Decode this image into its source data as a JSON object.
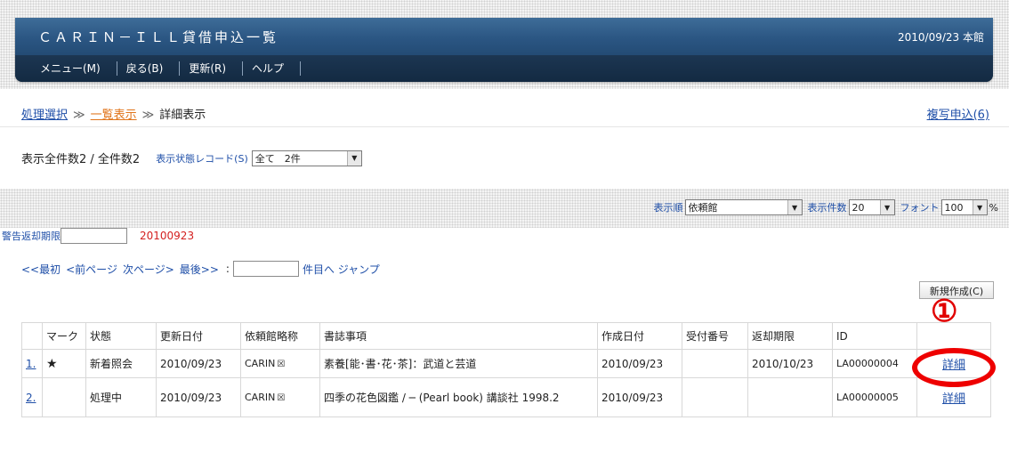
{
  "header": {
    "title": "ＣＡＲＩＮ－ＩＬＬ貸借申込一覧",
    "date_branch": "2010/09/23 本館",
    "menu": [
      {
        "label": "メニュー(M)"
      },
      {
        "label": "戻る(B)"
      },
      {
        "label": "更新(R)"
      },
      {
        "label": "ヘルプ"
      }
    ]
  },
  "breadcrumb": {
    "step1": "処理選択",
    "sep": "≫",
    "step2": "一覧表示",
    "step3": "詳細表示"
  },
  "copy_request": "複写申込(6)",
  "counts": {
    "text": "表示全件数2 / 全件数2",
    "status_label": "表示状態レコード(S)",
    "status_value": "全て　2件"
  },
  "controls": {
    "sort_label": "表示順",
    "sort_value": "依頼館",
    "perpage_label": "表示件数",
    "perpage_value": "20",
    "font_label": "フォント",
    "font_value": "100",
    "font_unit": "%"
  },
  "warning": {
    "label": "警告返却期限",
    "value": "",
    "date": "20100923"
  },
  "pager": {
    "first": "<<最初",
    "prev": "<前ページ",
    "next": "次ページ>",
    "last": "最後>>",
    "colon": ":",
    "jump_value": "",
    "jump_label": "件目へ ジャンプ"
  },
  "new_button": "新規作成(C)",
  "annotation": "①",
  "table": {
    "headers": [
      "",
      "マーク",
      "状態",
      "更新日付",
      "依頼館略称",
      "書誌事項",
      "作成日付",
      "受付番号",
      "返却期限",
      "ID",
      ""
    ],
    "rows": [
      {
        "no": "1.",
        "mark": "★",
        "status": "新着照会",
        "updated": "2010/09/23",
        "library": "CARIN",
        "library_icon": "☒",
        "bib": "素養[能･書･花･茶]：武道と芸道",
        "created": "2010/09/23",
        "receipt": "",
        "due": "2010/10/23",
        "id": "LA00000004",
        "detail": "詳細"
      },
      {
        "no": "2.",
        "mark": "",
        "status": "処理中",
        "updated": "2010/09/23",
        "library": "CARIN",
        "library_icon": "☒",
        "bib": "四季の花色図鑑 / ─ (Pearl book) 講談社 1998.2",
        "created": "2010/09/23",
        "receipt": "",
        "due": "",
        "id": "LA00000005",
        "detail": "詳細"
      }
    ]
  },
  "colors": {
    "header_bg": "#2b5683",
    "link": "#1f4fa8",
    "current": "#e0741a",
    "warning": "#d42020",
    "annotation": "#ee0000"
  }
}
